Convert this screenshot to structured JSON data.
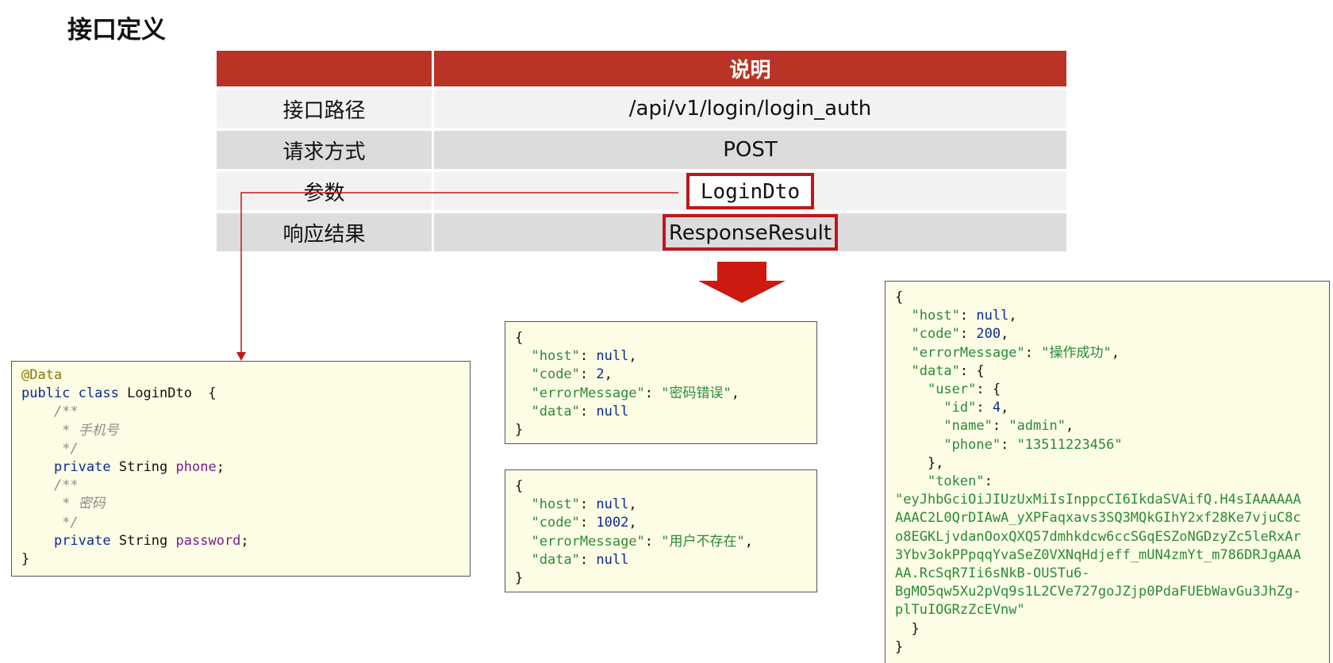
{
  "title": "接口定义",
  "table": {
    "header": {
      "col1": "",
      "col2": "说明"
    },
    "rows": [
      {
        "label": "接口路径",
        "value": "/api/v1/login/login_auth"
      },
      {
        "label": "请求方式",
        "value": "POST"
      },
      {
        "label": "参数",
        "value": "LoginDto"
      },
      {
        "label": "响应结果",
        "value": "ResponseResult"
      }
    ]
  },
  "login_dto": {
    "annotation": "@Data",
    "class_kw": "public class",
    "class_name": "LoginDto  {",
    "comment_open": "/**",
    "comment_phone": "* 手机号",
    "comment_close": "*/",
    "private_kw": "private",
    "type": "String",
    "field_phone": "phone",
    "comment_password": "* 密码",
    "field_password": "password",
    "semicolon": ";",
    "close": "}"
  },
  "response_password_error": {
    "host_key": "\"host\"",
    "host_val": "null",
    "code_key": "\"code\"",
    "code_val": "2",
    "msg_key": "\"errorMessage\"",
    "msg_val": "\"密码错误\"",
    "data_key": "\"data\"",
    "data_val": "null"
  },
  "response_user_missing": {
    "host_key": "\"host\"",
    "host_val": "null",
    "code_key": "\"code\"",
    "code_val": "1002",
    "msg_key": "\"errorMessage\"",
    "msg_val": "\"用户不存在\"",
    "data_key": "\"data\"",
    "data_val": "null"
  },
  "response_success": {
    "host_key": "\"host\"",
    "host_val": "null",
    "code_key": "\"code\"",
    "code_val": "200",
    "msg_key": "\"errorMessage\"",
    "msg_val": "\"操作成功\"",
    "data_key": "\"data\"",
    "user_key": "\"user\"",
    "id_key": "\"id\"",
    "id_val": "4",
    "name_key": "\"name\"",
    "name_val": "\"admin\"",
    "phone_key": "\"phone\"",
    "phone_val": "\"13511223456\"",
    "token_key": "\"token\"",
    "token_lines": [
      "\"eyJhbGciOiJIUzUxMiIsInppcCI6IkdaSVAifQ.H4sIAAAAAA",
      "AAAC2L0QrDIAwA_yXPFaqxavs3SQ3MQkGIhY2xf28Ke7vjuC8c",
      "o8EGKLjvdanOoxQXQ57dmhkdcw6ccSGqESZoNGDzyZc5leRxAr",
      "3Ybv3okPPpqqYvaSeZ0VXNqHdjeff_mUN4zmYt_m786DRJgAAA",
      "AA.RcSqR7Ii6sNkB-OUSTu6-",
      "BgMO5qw5Xu2pVq9s1L2CVe727goJZjp0PdaFUEbWavGu3JhZg-",
      "plTuIOGRzZcEVnw\""
    ]
  },
  "colors": {
    "header_red": "#b93426",
    "highlight_red": "#c0161b",
    "code_bg": "#fdfde5"
  }
}
